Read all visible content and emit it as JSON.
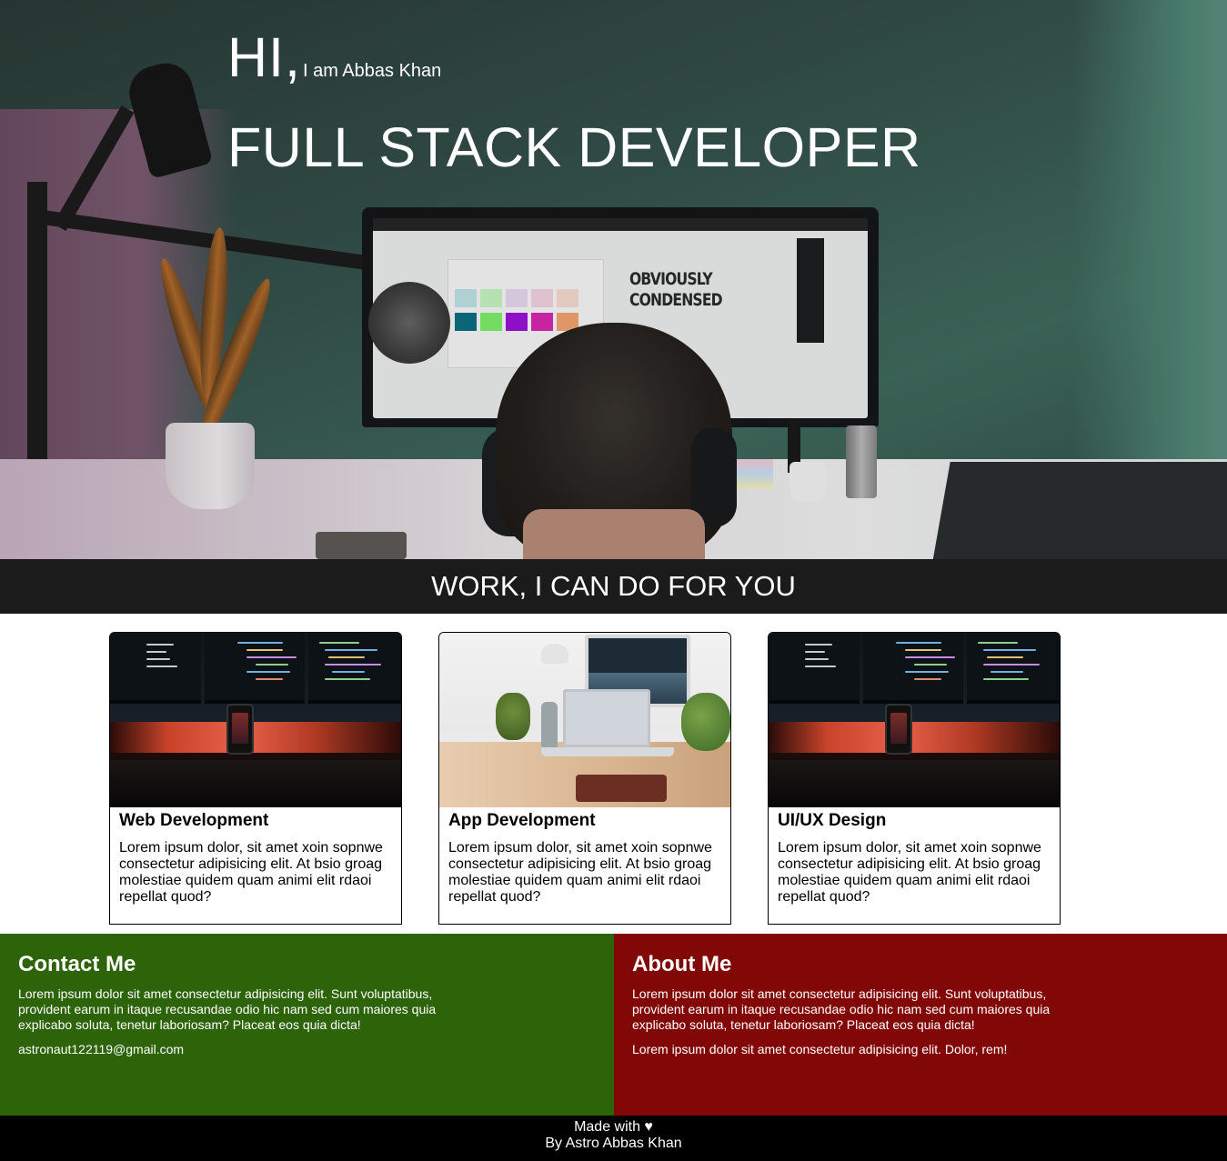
{
  "hero": {
    "greeting": "HI,",
    "intro": "I am Abbas Khan",
    "role": "FULL STACK DEVELOPER",
    "screen_text": "OBVIOUSLY CONDENSED"
  },
  "work": {
    "heading": "WORK, I CAN DO FOR YOU",
    "cards": [
      {
        "title": "Web Development",
        "text": "Lorem ipsum dolor, sit amet xoin sopnwe consectetur adipisicing elit. At bsio groag molestiae quidem quam animi elit rdaoi repellat quod?"
      },
      {
        "title": "App Development",
        "text": "Lorem ipsum dolor, sit amet xoin sopnwe consectetur adipisicing elit. At bsio groag molestiae quidem quam animi elit rdaoi repellat quod?"
      },
      {
        "title": "UI/UX Design",
        "text": "Lorem ipsum dolor, sit amet xoin sopnwe consectetur adipisicing elit. At bsio groag molestiae quidem quam animi elit rdaoi repellat quod?"
      }
    ]
  },
  "contact": {
    "title": "Contact Me",
    "text": "Lorem ipsum dolor sit amet consectetur adipisicing elit. Sunt voluptatibus, provident earum in itaque recusandae odio hic nam sed cum maiores quia explicabo soluta, tenetur laboriosam? Placeat eos quia dicta!",
    "email": "astronaut122119@gmail.com",
    "bg_color": "#2e6409"
  },
  "about": {
    "title": "About Me",
    "text": "Lorem ipsum dolor sit amet consectetur adipisicing elit. Sunt voluptatibus, provident earum in itaque recusandae odio hic nam sed cum maiores quia explicabo soluta, tenetur laboriosam? Placeat eos quia dicta!",
    "extra": "Lorem ipsum dolor sit amet consectetur adipisicing elit. Dolor, rem!",
    "bg_color": "#820808"
  },
  "footer": {
    "line1": "Made with ♥",
    "line2": "By Astro Abbas Khan"
  }
}
